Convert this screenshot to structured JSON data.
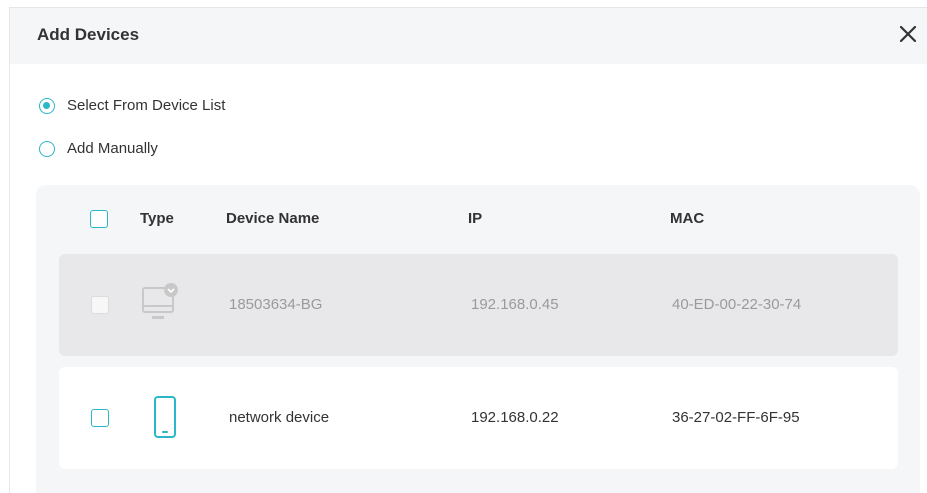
{
  "dialog": {
    "title": "Add Devices",
    "close_icon": "close-icon"
  },
  "options": [
    {
      "label": "Select From Device List",
      "selected": true
    },
    {
      "label": "Add Manually",
      "selected": false
    }
  ],
  "table": {
    "columns": [
      "Type",
      "Device Name",
      "IP",
      "MAC"
    ],
    "rows": [
      {
        "type_icon": "desktop-icon",
        "name": "18503634-BG",
        "ip": "192.168.0.45",
        "mac": "40-ED-00-22-30-74",
        "disabled": true,
        "checked": false
      },
      {
        "type_icon": "phone-icon",
        "name": "network device",
        "ip": "192.168.0.22",
        "mac": "36-27-02-FF-6F-95",
        "disabled": false,
        "checked": false
      }
    ]
  },
  "colors": {
    "accent": "#2ab7c7",
    "header_bg": "#f5f6f8",
    "disabled_row_bg": "#e8e8ea"
  }
}
